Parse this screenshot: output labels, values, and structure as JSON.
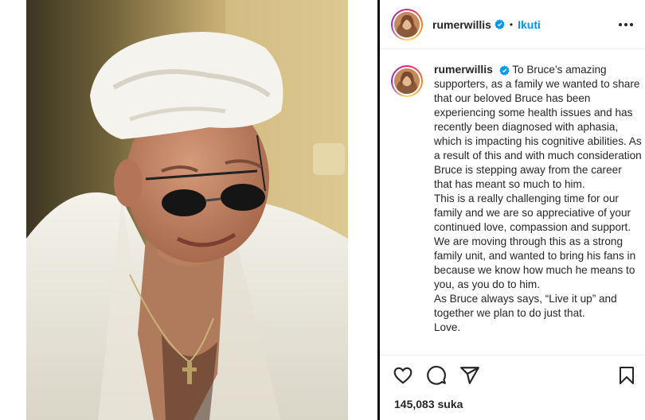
{
  "post": {
    "photo_alt": "photo"
  },
  "header": {
    "username": "rumerwillis",
    "verified_icon": "verified-badge-icon",
    "separator": "•",
    "follow_label": "Ikuti",
    "more_icon": "more-horizontal-icon"
  },
  "caption": {
    "username": "rumerwillis",
    "paragraphs": [
      "To Bruce’s amazing supporters, as a family we wanted to share that our beloved Bruce has been experiencing some health issues and has recently been diagnosed with aphasia, which is impacting his cognitive abilities. As a result of this and with much consideration Bruce is stepping away from the career that has meant so much to him.",
      "This is a really challenging time for our family and we are so appreciative of your continued love, compassion and support. We are moving through this as a strong family unit, and wanted to bring his fans in because we know how much he means to you, as you do to him.",
      "As Bruce always says, “Live it up” and together we plan to do just that.",
      "Love."
    ]
  },
  "actions": {
    "like_icon": "heart-icon",
    "comment_icon": "comment-icon",
    "share_icon": "share-paper-plane-icon",
    "save_icon": "bookmark-icon"
  },
  "likes": {
    "count_label": "145,083 suka"
  },
  "colors": {
    "accent": "#0095f6",
    "text": "#262626",
    "divider": "#efefef"
  }
}
